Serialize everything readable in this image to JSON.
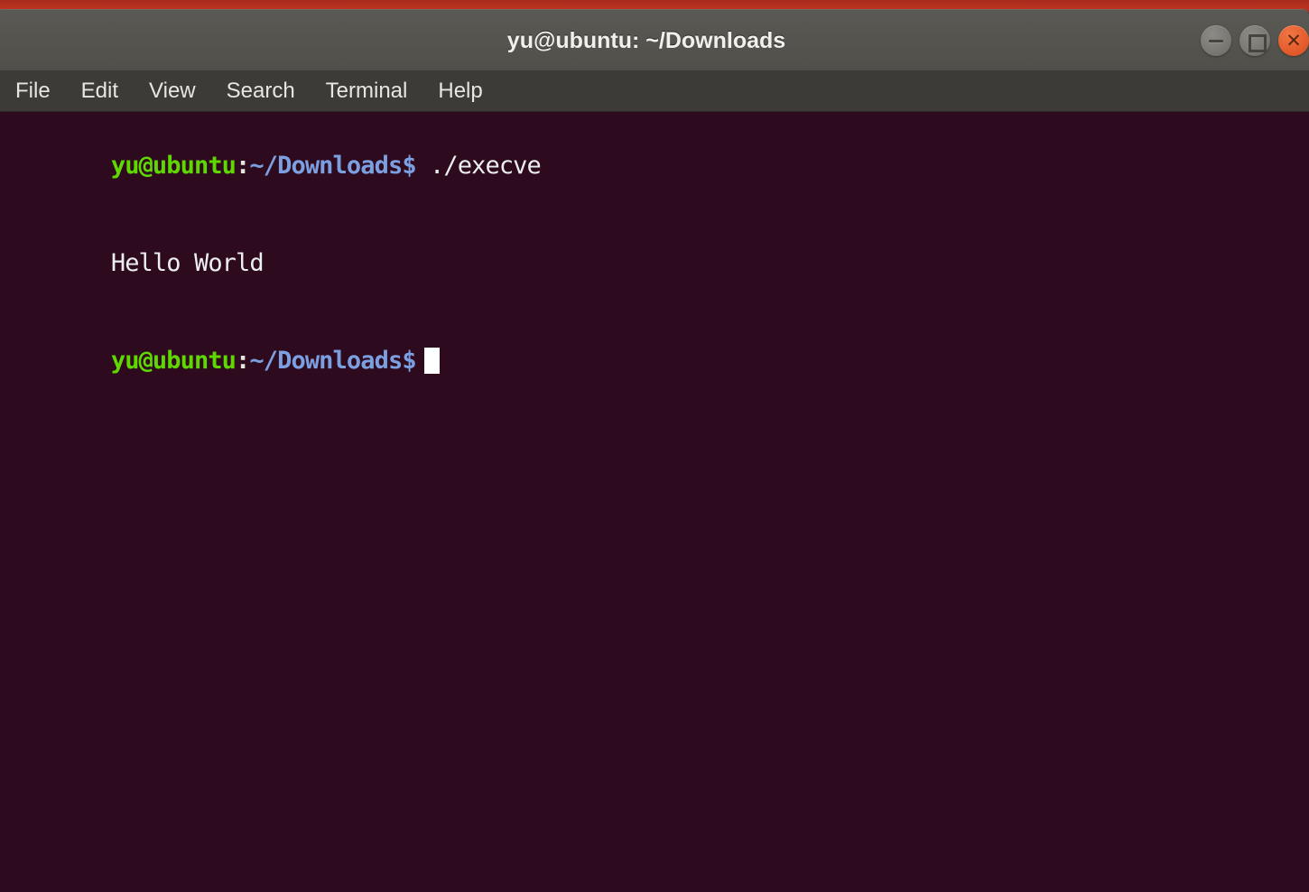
{
  "desktop": {
    "strip_color": "#b5301f"
  },
  "window": {
    "title": "yu@ubuntu: ~/Downloads",
    "controls": {
      "minimize_label": "minimize",
      "maximize_label": "maximize",
      "close_label": "✕"
    }
  },
  "menubar": {
    "items": [
      {
        "label": "File"
      },
      {
        "label": "Edit"
      },
      {
        "label": "View"
      },
      {
        "label": "Search"
      },
      {
        "label": "Terminal"
      },
      {
        "label": "Help"
      }
    ]
  },
  "terminal": {
    "background_color": "#2d0a1e",
    "prompt": {
      "user_host": "yu@ubuntu",
      "separator": ":",
      "path": "~/Downloads",
      "sigil": "$"
    },
    "lines": [
      {
        "type": "command",
        "user_host": "yu@ubuntu",
        "separator": ":",
        "path": "~/Downloads",
        "sigil": "$",
        "command": " ./execve"
      },
      {
        "type": "output",
        "text": "Hello World"
      },
      {
        "type": "prompt",
        "user_host": "yu@ubuntu",
        "separator": ":",
        "path": "~/Downloads",
        "sigil": "$",
        "command": ""
      }
    ],
    "colors": {
      "user": "#5fd700",
      "path": "#7b9fe0",
      "text": "#eceff1",
      "cursor": "#ffffff"
    }
  }
}
